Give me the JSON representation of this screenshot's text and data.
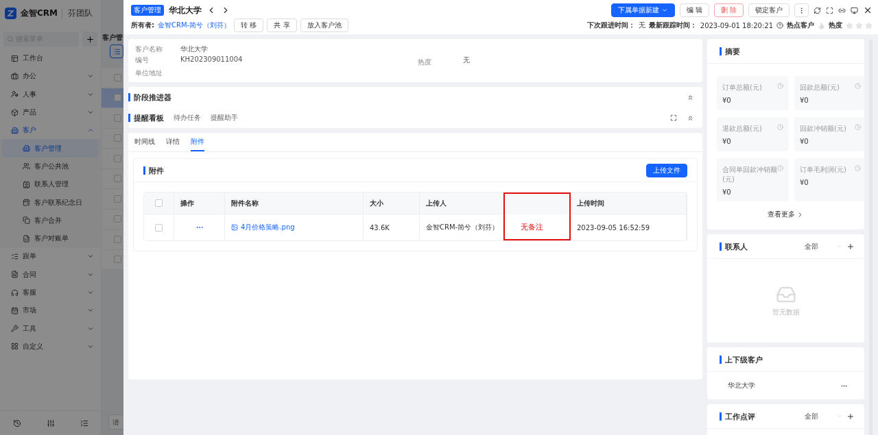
{
  "app": {
    "logo_text": "金智CRM",
    "team": "芬团队"
  },
  "sidebar": {
    "search_placeholder": "搜索菜单",
    "items": [
      {
        "label": "工作台",
        "kind": "link",
        "selected": false
      },
      {
        "label": "办公",
        "kind": "group",
        "expanded": false,
        "selected": false
      },
      {
        "label": "人事",
        "kind": "group",
        "expanded": false,
        "selected": false
      },
      {
        "label": "产品",
        "kind": "group",
        "expanded": false,
        "selected": false
      },
      {
        "label": "客户",
        "kind": "group",
        "expanded": true,
        "selected": true,
        "children": [
          {
            "label": "客户管理",
            "selected": true
          },
          {
            "label": "客户公共池",
            "selected": false
          },
          {
            "label": "联系人管理",
            "selected": false
          },
          {
            "label": "客户联系纪念日",
            "selected": false
          },
          {
            "label": "客户合并",
            "selected": false
          },
          {
            "label": "客户对账单",
            "selected": false
          }
        ]
      },
      {
        "label": "跟单",
        "kind": "group",
        "expanded": false,
        "selected": false
      },
      {
        "label": "合同",
        "kind": "group",
        "expanded": false,
        "selected": false
      },
      {
        "label": "客服",
        "kind": "group",
        "expanded": false,
        "selected": false
      },
      {
        "label": "市场",
        "kind": "group",
        "expanded": false,
        "selected": false
      },
      {
        "label": "工具",
        "kind": "group",
        "expanded": false,
        "selected": false
      },
      {
        "label": "自定义",
        "kind": "group",
        "expanded": false,
        "selected": false
      }
    ]
  },
  "background_list": {
    "title": "客户管",
    "rows": [
      {
        "checked": false,
        "selected": false
      },
      {
        "checked": false,
        "selected": true
      },
      {
        "checked": false,
        "selected": false
      },
      {
        "checked": false,
        "selected": false
      },
      {
        "checked": false,
        "selected": false
      },
      {
        "checked": false,
        "selected": false
      },
      {
        "checked": false,
        "selected": false
      },
      {
        "checked": false,
        "selected": false
      },
      {
        "checked": false,
        "selected": false
      },
      {
        "checked": false,
        "selected": false
      }
    ],
    "footer_placeholder": "请"
  },
  "header": {
    "badge": "客户管理",
    "title": "华北大学",
    "actions": [
      {
        "label": "下属单据新建",
        "kind": "primary-dropdown"
      },
      {
        "label": "编 辑",
        "kind": "default"
      },
      {
        "label": "删 除",
        "kind": "danger"
      },
      {
        "label": "锁定客户",
        "kind": "default"
      },
      {
        "kind": "more"
      }
    ]
  },
  "owner": {
    "label": "所有者:",
    "value": "金智CRM-简兮（刘芬）",
    "actions": [
      "转 移",
      "共 享",
      "放入客户池"
    ]
  },
  "meta": {
    "next_follow_label": "下次跟进时间：",
    "next_follow": "无",
    "last_track_label": "最新跟踪时间：",
    "last_track": "2023-09-01 18:20:21",
    "hot_label": "热点客户",
    "hot": false,
    "heat_label": "热度",
    "stars": 0
  },
  "info": {
    "fields": [
      {
        "label": "客户名称",
        "value": "华北大学"
      },
      {
        "label": "编号",
        "value": "KH202309011004"
      },
      {
        "label": "单位地址"
      }
    ],
    "side_fields": [
      {
        "label": "热度",
        "value": "无"
      }
    ]
  },
  "stage": {
    "title": "阶段推进器"
  },
  "reminder": {
    "title": "提醒看板",
    "tabs": [
      "待办任务",
      "提醒助手"
    ]
  },
  "detail_tabs": [
    {
      "label": "时间线",
      "selected": false
    },
    {
      "label": "详情",
      "selected": false
    },
    {
      "label": "附件",
      "selected": true
    }
  ],
  "attachments": {
    "title": "附件",
    "upload_button": "上传文件",
    "all_checked": false,
    "columns": [
      {
        "label": "操作",
        "annotated": false
      },
      {
        "label": "附件名称",
        "annotated": false
      },
      {
        "label": "大小",
        "annotated": false
      },
      {
        "label": "上传人",
        "annotated": false
      },
      {
        "annotated": true
      },
      {
        "label": "上传时间",
        "annotated": false
      }
    ],
    "rows": [
      {
        "checked": false,
        "name": "4月价格策略.png",
        "size": "43.6K",
        "uploader": "金智CRM-简兮（刘芬）",
        "column_5": "无备注",
        "uploaded": "2023-09-05 16:52:59"
      }
    ]
  },
  "summary": {
    "title": "摘要",
    "metrics": [
      {
        "label": "订单总额(元)",
        "value": "¥0"
      },
      {
        "label": "回款总额(元)",
        "value": "¥0"
      },
      {
        "label": "退款总额(元)",
        "value": "¥0"
      },
      {
        "label": "回款冲销额(元)",
        "value": "¥0"
      },
      {
        "label": "合同单回款冲销额(元)",
        "value": "¥0"
      },
      {
        "label": "订单毛利润(元)",
        "value": "¥0"
      }
    ],
    "more": "查看更多"
  },
  "contacts": {
    "title": "联系人",
    "filter": "全部",
    "empty_text": "暂无数据"
  },
  "related": {
    "title": "上下级客户",
    "items": [
      "华北大学"
    ]
  },
  "reviews": {
    "title": "工作点评",
    "filter": "全部"
  }
}
